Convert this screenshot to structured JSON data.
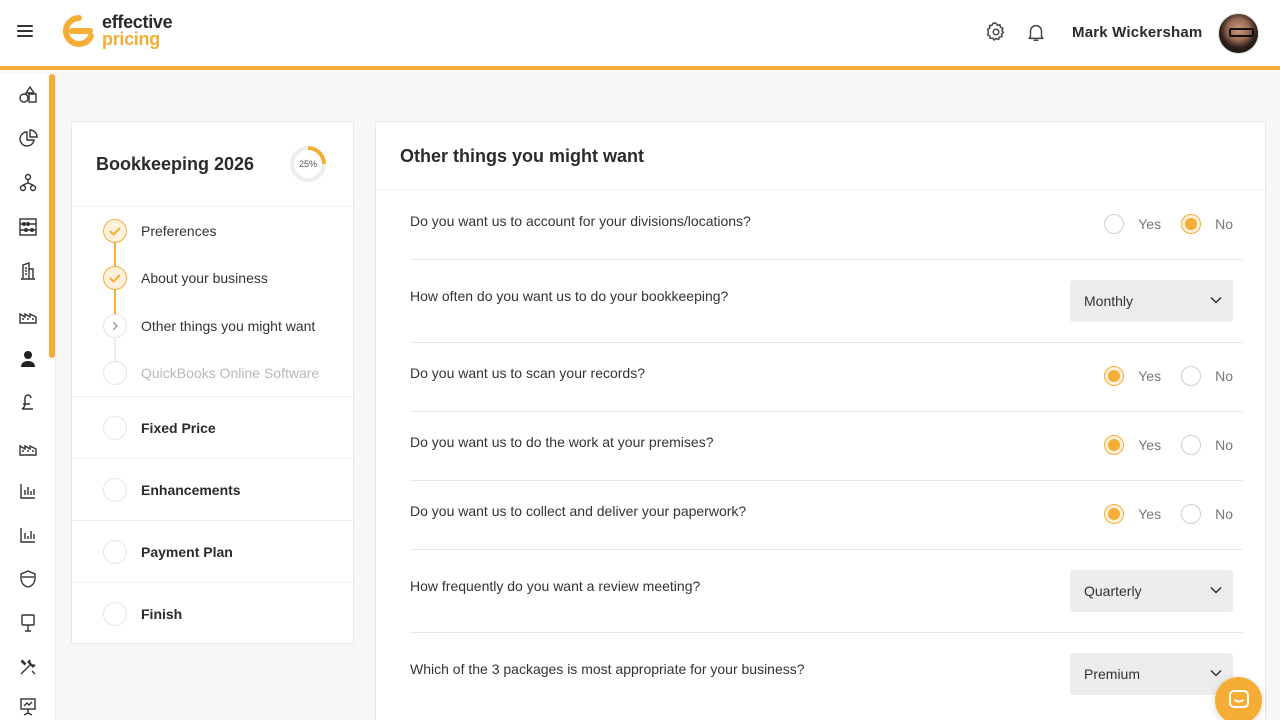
{
  "brand": {
    "line1": "effective",
    "line2": "pricing",
    "accent": "#f5ad36"
  },
  "header": {
    "user_name": "Mark Wickersham"
  },
  "sidebar": {
    "title": "Bookkeeping 2026",
    "progress_label": "25%",
    "progress_value": 0.25,
    "substeps": [
      {
        "label": "Preferences",
        "state": "done"
      },
      {
        "label": "About your business",
        "state": "done"
      },
      {
        "label": "Other things you might want",
        "state": "current"
      },
      {
        "label": "QuickBooks Online Software",
        "state": "pending"
      }
    ],
    "sections": [
      {
        "label": "Fixed Price"
      },
      {
        "label": "Enhancements"
      },
      {
        "label": "Payment Plan"
      },
      {
        "label": "Finish"
      }
    ]
  },
  "main": {
    "title": "Other things you might want",
    "yes_label": "Yes",
    "no_label": "No",
    "questions": [
      {
        "text": "Do you want us to account for your divisions/locations?",
        "type": "radio",
        "value": "No"
      },
      {
        "text": "How often do you want us to do your bookkeeping?",
        "type": "select",
        "value": "Monthly"
      },
      {
        "text": "Do you want us to scan your records?",
        "type": "radio",
        "value": "Yes"
      },
      {
        "text": "Do you want us to do the work at your premises?",
        "type": "radio",
        "value": "Yes"
      },
      {
        "text": "Do you want us to collect and deliver your paperwork?",
        "type": "radio",
        "value": "Yes"
      },
      {
        "text": "How frequently do you want a review meeting?",
        "type": "select",
        "value": "Quarterly"
      },
      {
        "text": "Which of the 3 packages is most appropriate for your business?",
        "type": "select",
        "value": "Premium"
      }
    ]
  },
  "rail_icons": [
    "shapes-icon",
    "pie-chart-icon",
    "org-chart-icon",
    "abacus-icon",
    "building-icon",
    "factory-icon",
    "user-icon",
    "pound-icon",
    "factory-alt-icon",
    "bar-chart-icon",
    "bar-chart-alt-icon",
    "shield-icon",
    "sign-icon",
    "tools-icon",
    "presentation-icon"
  ]
}
